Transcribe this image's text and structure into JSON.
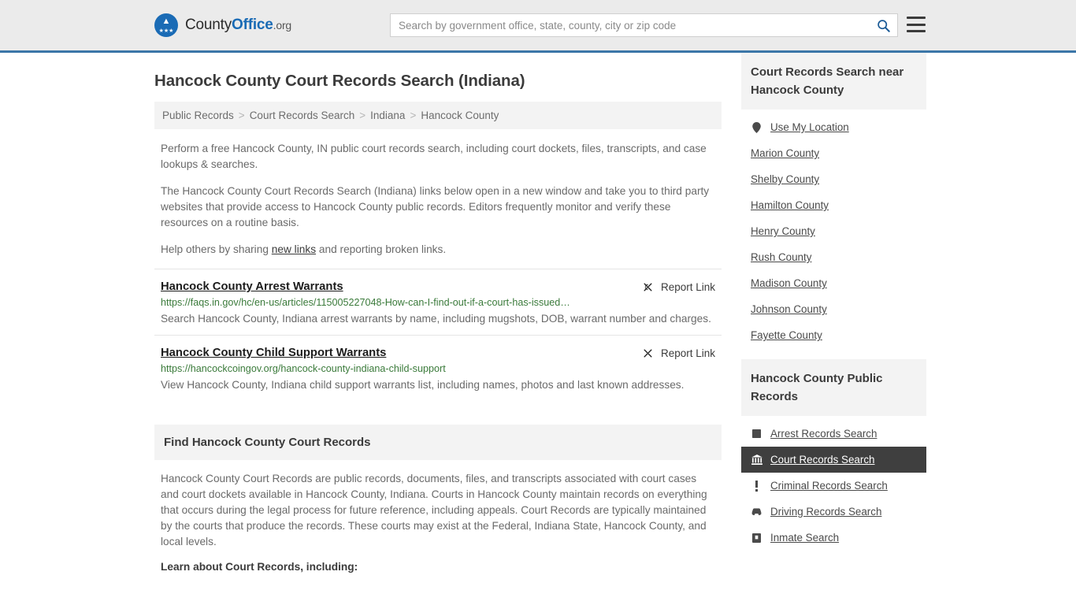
{
  "header": {
    "brand_prefix": "County",
    "brand_bold": "Office",
    "brand_suffix": ".org",
    "search_placeholder": "Search by government office, state, county, city or zip code",
    "search_value": "",
    "search_icon": "search-icon",
    "menu_icon": "hamburger-menu-icon",
    "logo_icon": "county-office-eagle-logo",
    "accent_color": "#3b76a8"
  },
  "page": {
    "title": "Hancock County Court Records Search (Indiana)"
  },
  "breadcrumb": {
    "separator": ">",
    "items": [
      {
        "label": "Public Records"
      },
      {
        "label": "Court Records Search"
      },
      {
        "label": "Indiana"
      },
      {
        "label": "Hancock County"
      }
    ]
  },
  "intro": {
    "p1": "Perform a free Hancock County, IN public court records search, including court dockets, files, transcripts, and case lookups & searches.",
    "p2": "The Hancock County Court Records Search (Indiana) links below open in a new window and take you to third party websites that provide access to Hancock County public records. Editors frequently monitor and verify these resources on a routine basis.",
    "p3_before": "Help others by sharing ",
    "p3_link": "new links",
    "p3_after": " and reporting broken links."
  },
  "results": {
    "report_label": "Report Link",
    "report_icon": "broken-link-icon",
    "items": [
      {
        "title": "Hancock County Arrest Warrants",
        "url": "https://faqs.in.gov/hc/en-us/articles/115005227048-How-can-I-find-out-if-a-court-has-issued…",
        "description": "Search Hancock County, Indiana arrest warrants by name, including mugshots, DOB, warrant number and charges."
      },
      {
        "title": "Hancock County Child Support Warrants",
        "url": "https://hancockcoingov.org/hancock-county-indiana-child-support",
        "description": "View Hancock County, Indiana child support warrants list, including names, photos and last known addresses."
      }
    ]
  },
  "find_section": {
    "heading": "Find Hancock County Court Records",
    "body": "Hancock County Court Records are public records, documents, files, and transcripts associated with court cases and court dockets available in Hancock County, Indiana. Courts in Hancock County maintain records on everything that occurs during the legal process for future reference, including appeals. Court Records are typically maintained by the courts that produce the records. These courts may exist at the Federal, Indiana State, Hancock County, and local levels.",
    "subheading": "Learn about Court Records, including:"
  },
  "sidebar": {
    "nearby": {
      "heading": "Court Records Search near Hancock County",
      "items": [
        {
          "label": "Use My Location",
          "icon": "map-pin-icon"
        },
        {
          "label": "Marion County",
          "icon": ""
        },
        {
          "label": "Shelby County",
          "icon": ""
        },
        {
          "label": "Hamilton County",
          "icon": ""
        },
        {
          "label": "Henry County",
          "icon": ""
        },
        {
          "label": "Rush County",
          "icon": ""
        },
        {
          "label": "Madison County",
          "icon": ""
        },
        {
          "label": "Johnson County",
          "icon": ""
        },
        {
          "label": "Fayette County",
          "icon": ""
        }
      ]
    },
    "public_records": {
      "heading": "Hancock County Public Records",
      "active_label": "Court Records Search",
      "items": [
        {
          "label": "Arrest Records Search",
          "icon": "fingerprint-icon",
          "active": false
        },
        {
          "label": "Court Records Search",
          "icon": "courthouse-icon",
          "active": true
        },
        {
          "label": "Criminal Records Search",
          "icon": "exclamation-icon",
          "active": false
        },
        {
          "label": "Driving Records Search",
          "icon": "car-icon",
          "active": false
        },
        {
          "label": "Inmate Search",
          "icon": "jail-icon",
          "active": false
        }
      ]
    }
  }
}
